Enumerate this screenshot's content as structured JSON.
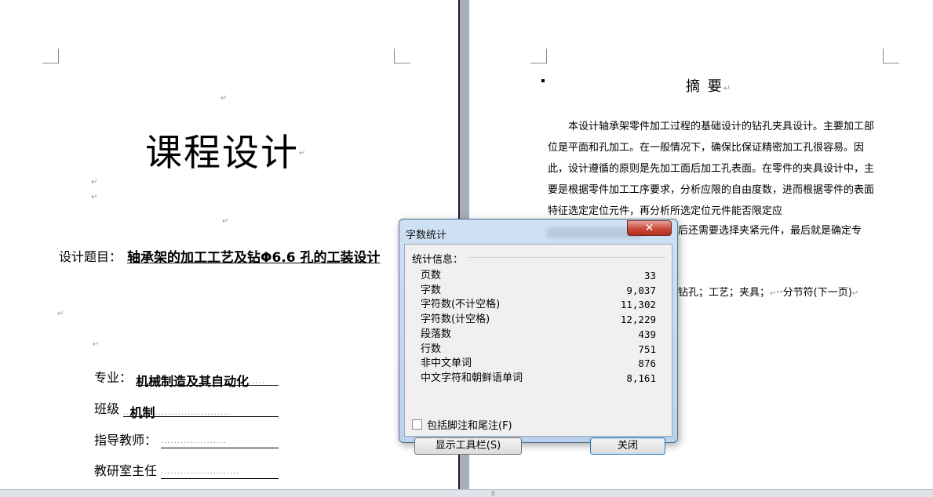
{
  "left_page": {
    "title": "课程设计",
    "topic_label": "设计题目：",
    "topic_value": "轴承架的加工工艺及钻Φ6.6  孔的工装设计",
    "fields": [
      {
        "label": "专业：",
        "value": "机械制造及其自动化"
      },
      {
        "label": "班级",
        "value": "机制"
      },
      {
        "label": "指导教师：",
        "value": ""
      },
      {
        "label": "教研室主任",
        "value": ""
      }
    ]
  },
  "right_page": {
    "heading": "摘  要",
    "body": "本设计轴承架零件加工过程的基础设计的钻孔夹具设计。主要加工部位是平面和孔加工。在一般情况下，确保比保证精密加工孔很容易。因此，设计遵循的原则是先加工面后加工孔表面。在零件的夹具设计中，主要是根据零件加工工序要求，分析应限的自由度数，进而根据零件的表面特征选定定位元件，再分析所选定位元件能否限定应",
    "body_tail": "后还需要选择夹紧元件，最后就是确定专",
    "keywords_tail": "钻孔；工艺；夹具；",
    "section_break": "分节符(下一页)"
  },
  "dialog": {
    "title": "字数统计",
    "close_icon": "close-icon",
    "section_label": "统计信息：",
    "stats": [
      {
        "label": "页数",
        "value": "33"
      },
      {
        "label": "字数",
        "value": "9,037"
      },
      {
        "label": "字符数(不计空格)",
        "value": "11,302"
      },
      {
        "label": "字符数(计空格)",
        "value": "12,229"
      },
      {
        "label": "段落数",
        "value": "439"
      },
      {
        "label": "行数",
        "value": "751"
      },
      {
        "label": "非中文单词",
        "value": "876"
      },
      {
        "label": "中文字符和朝鲜语单词",
        "value": "8,161"
      }
    ],
    "checkbox_label": "包括脚注和尾注(F)",
    "checkbox_checked": false,
    "toolbar_button": "显示工具栏(S)",
    "close_button": "关闭"
  }
}
